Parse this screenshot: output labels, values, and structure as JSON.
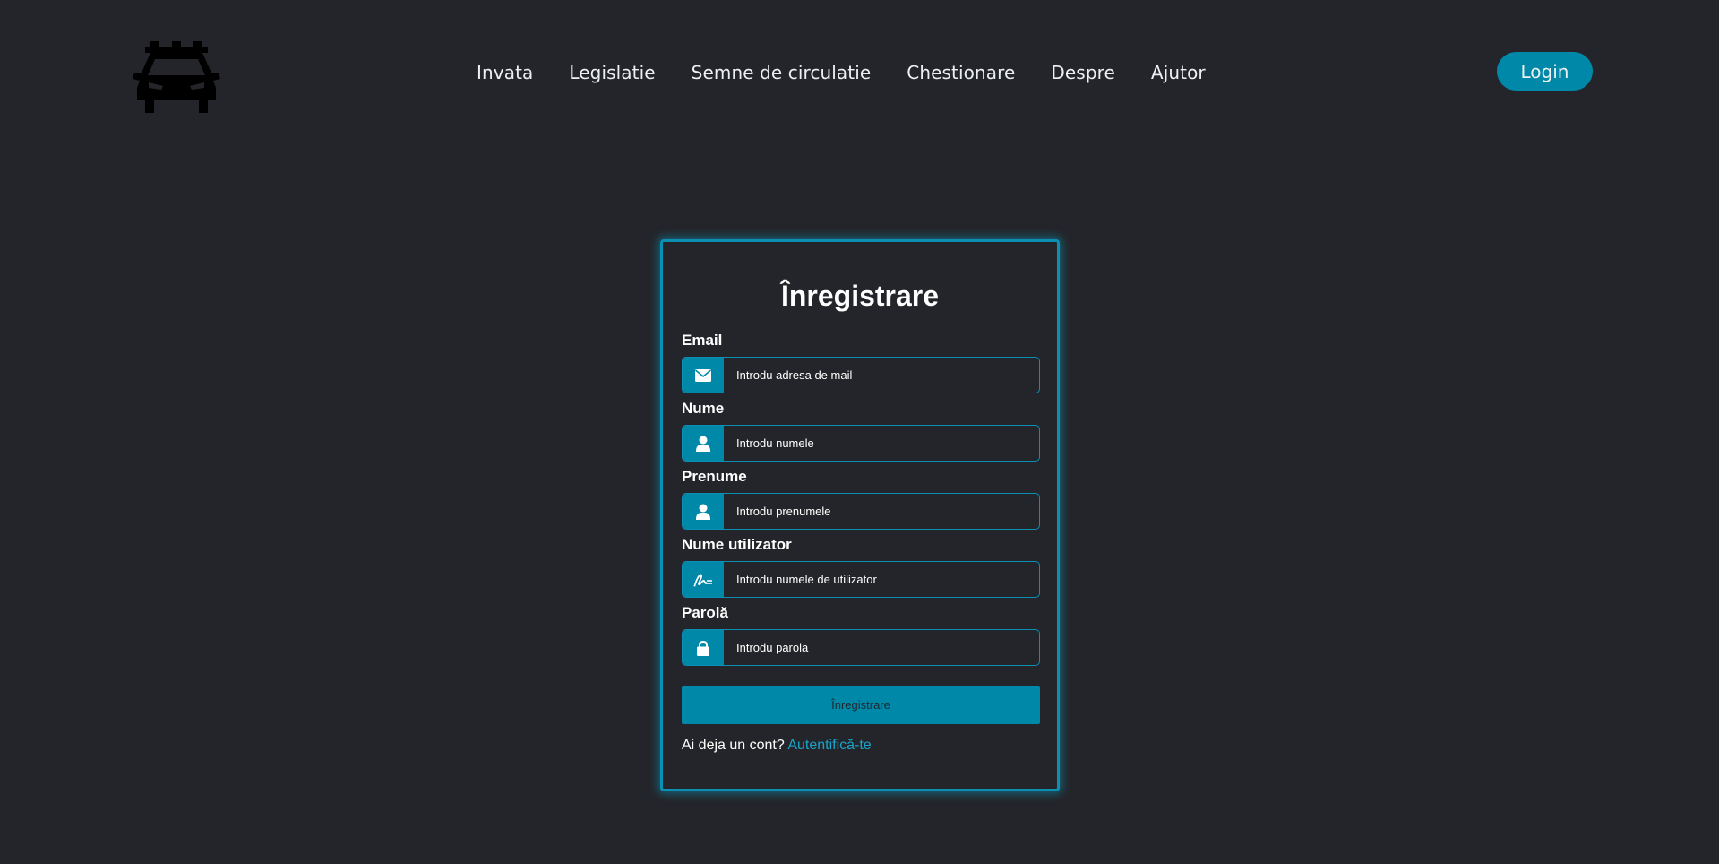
{
  "header": {
    "logo_icon": "police-car-icon",
    "nav": [
      {
        "label": "Invata"
      },
      {
        "label": "Legislatie"
      },
      {
        "label": "Semne de circulatie"
      },
      {
        "label": "Chestionare"
      },
      {
        "label": "Despre"
      },
      {
        "label": "Ajutor"
      }
    ],
    "login_label": "Login"
  },
  "form": {
    "title": "Înregistrare",
    "fields": [
      {
        "label": "Email",
        "placeholder": "Introdu adresa de mail",
        "icon": "envelope-icon"
      },
      {
        "label": "Nume",
        "placeholder": "Introdu numele",
        "icon": "user-icon"
      },
      {
        "label": "Prenume",
        "placeholder": "Introdu prenumele",
        "icon": "user-icon"
      },
      {
        "label": "Nume utilizator",
        "placeholder": "Introdu numele de utilizator",
        "icon": "signature-icon"
      },
      {
        "label": "Parolă",
        "placeholder": "Introdu parola",
        "icon": "lock-icon"
      }
    ],
    "submit_label": "Înregistrare",
    "has_account_text": "Ai deja un cont?",
    "signin_link": "Autentifică-te"
  },
  "colors": {
    "background": "#24252a",
    "accent": "#0088a9",
    "border": "#0b8fb2",
    "text": "#edf0f1"
  }
}
